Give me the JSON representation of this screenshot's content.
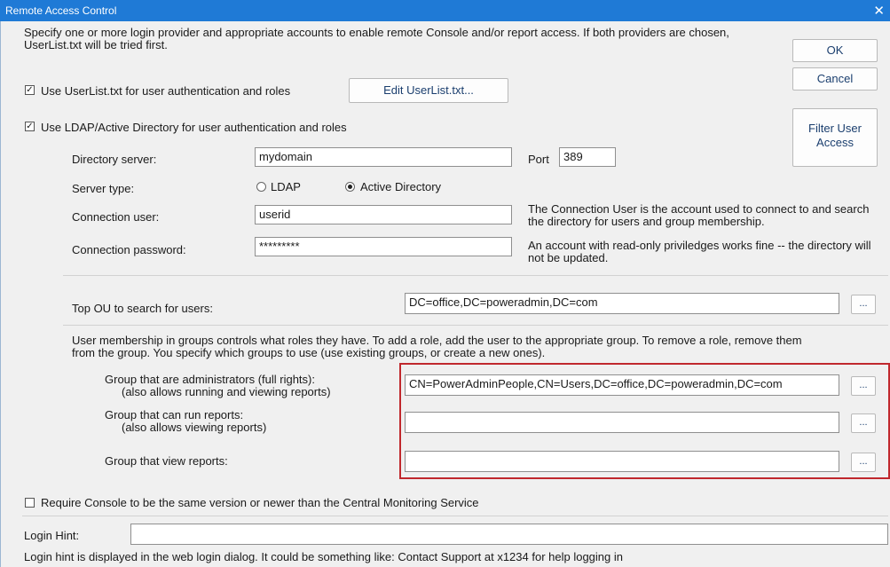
{
  "window": {
    "title": "Remote Access Control"
  },
  "intro": "Specify one or more login provider and appropriate accounts to enable remote Console and/or report access.  If both providers are chosen, UserList.txt will be tried first.",
  "buttons": {
    "ok": "OK",
    "cancel": "Cancel",
    "filter": "Filter User Access",
    "edit_userlist": "Edit UserList.txt...",
    "browse": "..."
  },
  "userlist": {
    "checked": true,
    "label": "Use UserList.txt for user authentication and roles"
  },
  "ldap": {
    "checked": true,
    "label": "Use LDAP/Active Directory for user authentication and roles",
    "directory_server_label": "Directory server:",
    "directory_server_value": "mydomain",
    "port_label": "Port",
    "port_value": "389",
    "server_type_label": "Server type:",
    "server_type_options": [
      "LDAP",
      "Active Directory"
    ],
    "server_type_selected": "Active Directory",
    "connection_user_label": "Connection user:",
    "connection_user_value": "userid",
    "connection_password_label": "Connection password:",
    "connection_password_value": "*********",
    "connection_user_note": "The Connection User is the account used to connect to and search the directory for users and group membership.",
    "password_note": "An account with read-only priviledges works fine -- the directory will not be updated.",
    "top_ou_label": "Top OU to search for users:",
    "top_ou_value": "DC=office,DC=poweradmin,DC=com"
  },
  "groups": {
    "description": "User membership in groups controls what roles they have.  To add a role, add the user to the appropriate group.  To remove a role, remove them from the group.  You specify which groups to use (use existing groups, or create a new ones).",
    "admin_label": "Group that are administrators (full rights):",
    "admin_sub": "(also allows running and viewing reports)",
    "admin_value": "CN=PowerAdminPeople,CN=Users,DC=office,DC=poweradmin,DC=com",
    "run_label": "Group that can run reports:",
    "run_sub": "(also allows viewing reports)",
    "run_value": "",
    "view_label": "Group that view reports:",
    "view_value": ""
  },
  "require_console": {
    "checked": false,
    "label": "Require Console to be the same version or newer than the Central Monitoring Service"
  },
  "login_hint": {
    "label": "Login Hint:",
    "value": "",
    "note": "Login hint is displayed in the web login dialog.  It could be something like: Contact Support at x1234 for help logging in"
  },
  "colors": {
    "titlebar": "#1f7ad6",
    "highlight": "#c0282d"
  }
}
